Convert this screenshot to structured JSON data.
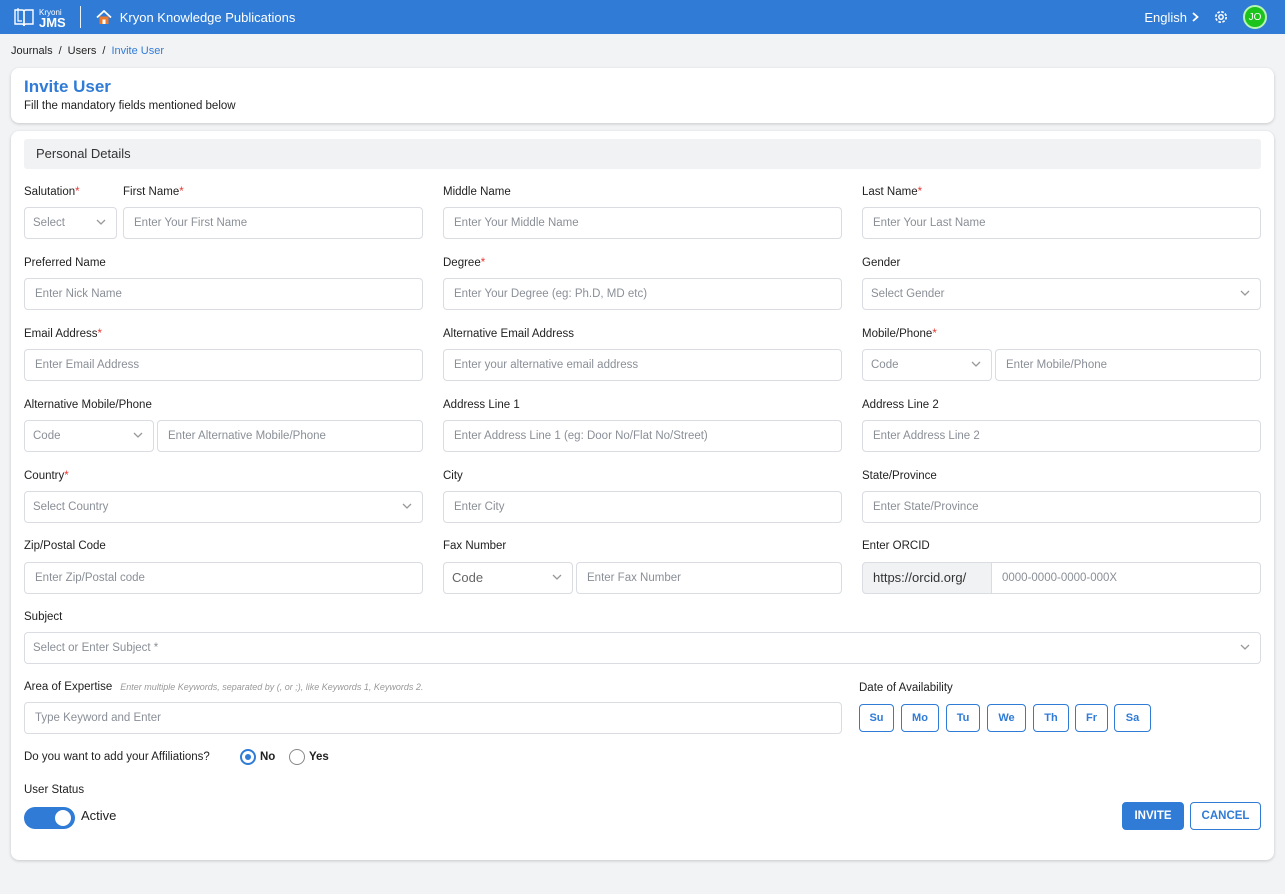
{
  "topbar": {
    "logo_small": "Kryoni",
    "logo_big": "JMS",
    "publication": "Kryon Knowledge Publications",
    "language": "English",
    "avatar_initials": "JO",
    "avatar_color": "#1cc31c",
    "brand_color": "#2f7bd6"
  },
  "breadcrumb": {
    "items": [
      "Journals",
      "Users",
      "Invite User"
    ]
  },
  "header": {
    "title": "Invite User",
    "subtitle": "Fill the mandatory fields mentioned below"
  },
  "section": {
    "title": "Personal Details"
  },
  "fields": {
    "salutation": {
      "label": "Salutation",
      "value": "Select"
    },
    "first_name": {
      "label": "First Name",
      "placeholder": "Enter Your First Name"
    },
    "middle_name": {
      "label": "Middle Name",
      "placeholder": "Enter Your Middle Name"
    },
    "last_name": {
      "label": "Last Name",
      "placeholder": "Enter Your Last Name"
    },
    "preferred_name": {
      "label": "Preferred Name",
      "placeholder": "Enter Nick Name"
    },
    "degree": {
      "label": "Degree",
      "placeholder": "Enter Your Degree (eg: Ph.D, MD etc)"
    },
    "gender": {
      "label": "Gender",
      "value": "Select Gender"
    },
    "email": {
      "label": "Email Address",
      "placeholder": "Enter Email Address"
    },
    "alt_email": {
      "label": "Alternative Email Address",
      "placeholder": "Enter your alternative email address"
    },
    "mobile": {
      "label": "Mobile/Phone",
      "code": "Code",
      "placeholder": "Enter Mobile/Phone"
    },
    "alt_mobile": {
      "label": "Alternative Mobile/Phone",
      "code": "Code",
      "placeholder": "Enter Alternative Mobile/Phone"
    },
    "address1": {
      "label": "Address Line 1",
      "placeholder": "Enter Address Line 1 (eg: Door No/Flat No/Street)"
    },
    "address2": {
      "label": "Address Line 2",
      "placeholder": "Enter Address Line 2"
    },
    "country": {
      "label": "Country",
      "value": "Select Country"
    },
    "city": {
      "label": "City",
      "placeholder": "Enter City"
    },
    "state": {
      "label": "State/Province",
      "placeholder": "Enter State/Province"
    },
    "zip": {
      "label": "Zip/Postal Code",
      "placeholder": "Enter Zip/Postal code"
    },
    "fax": {
      "label": "Fax Number",
      "code": "Code",
      "placeholder": "Enter Fax Number"
    },
    "orcid": {
      "label": "Enter ORCID",
      "prefix": "https://orcid.org/",
      "placeholder": "0000-0000-0000-000X"
    },
    "subject": {
      "label": "Subject",
      "value": "Select or Enter Subject *"
    },
    "expertise": {
      "label": "Area of Expertise",
      "hint": "Enter multiple Keywords, separated by (, or ;), like Keywords 1, Keywords 2.",
      "placeholder": "Type Keyword and Enter"
    },
    "availability": {
      "label": "Date of Availability",
      "days": [
        "Su",
        "Mo",
        "Tu",
        "We",
        "Th",
        "Fr",
        "Sa"
      ]
    }
  },
  "affiliations": {
    "question": "Do you want to add your Affiliations?",
    "no": "No",
    "yes": "Yes",
    "selected": "No"
  },
  "status": {
    "label": "User Status",
    "value": "Active"
  },
  "actions": {
    "invite": "INVITE",
    "cancel": "CANCEL"
  },
  "required_marker": "*"
}
